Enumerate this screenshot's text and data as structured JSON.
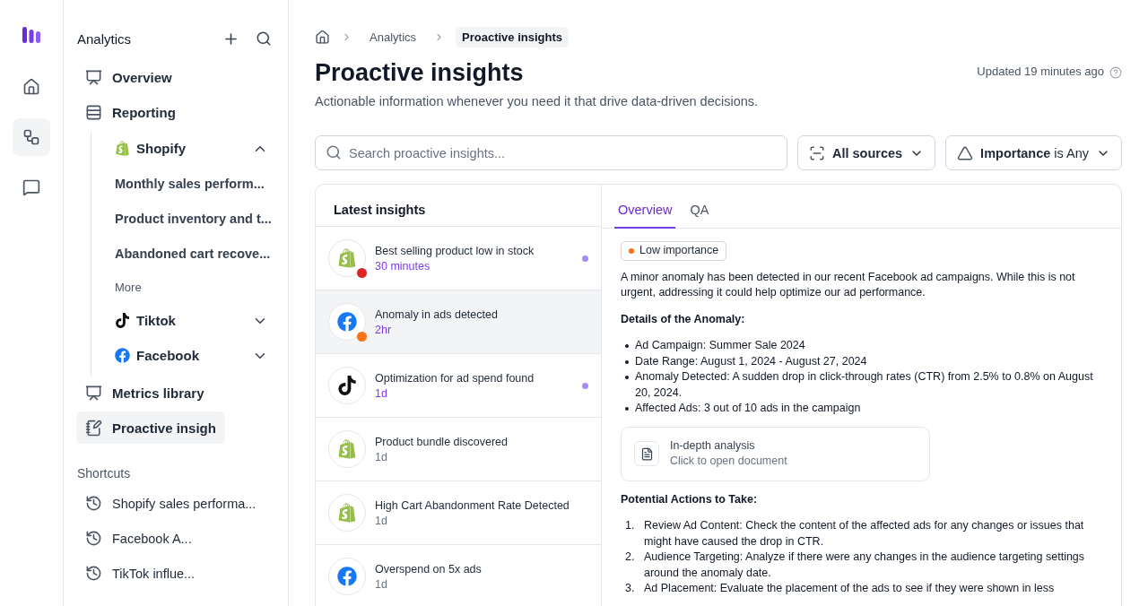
{
  "rail": {
    "items": [
      {
        "kind": "home",
        "selected": false
      },
      {
        "kind": "flows",
        "selected": true
      },
      {
        "kind": "chat",
        "selected": false
      }
    ]
  },
  "sidebar": {
    "title": "Analytics",
    "items": [
      {
        "kind": "overview",
        "label": "Overview",
        "selected": false
      },
      {
        "kind": "reporting",
        "label": "Reporting",
        "selected": false,
        "children": [
          {
            "kind": "shopify",
            "label": "Shopify",
            "expanded": true,
            "children": [
              {
                "label": "Monthly sales perform..."
              },
              {
                "label": "Product inventory and t..."
              },
              {
                "label": "Abandoned cart recove..."
              }
            ],
            "more": "More"
          },
          {
            "kind": "tiktok",
            "label": "Tiktok",
            "expanded": false
          },
          {
            "kind": "facebook",
            "label": "Facebook",
            "expanded": false
          }
        ]
      },
      {
        "kind": "overview",
        "label": "Metrics library",
        "selected": false
      },
      {
        "kind": "insights",
        "label": "Proactive insigh",
        "selected": true
      }
    ],
    "shortcuts_title": "Shortcuts",
    "shortcuts": [
      "Shopify sales performa...",
      "Facebook A...",
      "TikTok influe..."
    ]
  },
  "breadcrumb": [
    "Analytics",
    "Proactive insights"
  ],
  "page": {
    "title": "Proactive insights",
    "subtitle": "Actionable information whenever you need it that drive data-driven decisions.",
    "updated": "Updated 19 minutes ago"
  },
  "search": {
    "placeholder": "Search proactive insights..."
  },
  "filters": {
    "sources": "All sources",
    "importance": "**Importance** is Any"
  },
  "insights": {
    "title": "Latest insights",
    "items": [
      {
        "kind": "shopify",
        "title": "Best selling product low in stock",
        "time": "30 minutes",
        "recent": true,
        "unread": true,
        "selected": false,
        "color": "#dc2626"
      },
      {
        "kind": "facebook",
        "title": "Anomaly in ads detected",
        "time": "2hr",
        "recent": true,
        "unread": false,
        "selected": true,
        "color": "#f97316"
      },
      {
        "kind": "tiktok",
        "title": "Optimization for ad spend found",
        "time": "1d",
        "recent": true,
        "unread": true,
        "selected": false
      },
      {
        "kind": "shopify",
        "title": "Product bundle discovered",
        "time": "1d",
        "recent": false,
        "unread": false,
        "selected": false
      },
      {
        "kind": "shopify",
        "title": "High Cart Abandonment Rate Detected",
        "time": "1d",
        "recent": false,
        "unread": false,
        "selected": false
      },
      {
        "kind": "facebook",
        "title": "Overspend on 5x ads",
        "time": "1d",
        "recent": false,
        "unread": false,
        "selected": false
      }
    ]
  },
  "detail": {
    "tabs": [
      {
        "label": "Overview",
        "selected": true
      },
      {
        "label": "QA",
        "selected": false
      }
    ],
    "importance": {
      "label": "Low importance",
      "color": "#f97316"
    },
    "intro": "A minor anomaly has been detected in our recent Facebook ad campaigns. While this is not urgent, addressing it could help optimize our ad performance.",
    "details_title": "Details of the Anomaly:",
    "details": [
      "Ad Campaign: Summer Sale 2024",
      "Date Range: August 1, 2024 - August 27, 2024",
      "Anomaly Detected: A sudden drop in click-through rates (CTR) from 2.5% to 0.8% on August 20, 2024.",
      "Affected Ads: 3 out of 10 ads in the campaign"
    ],
    "document": {
      "title": "In-depth analysis",
      "subtitle": "Click to open document"
    },
    "actions_title": "Potential Actions to Take:",
    "actions": [
      {
        "number": "1.",
        "text": "Review Ad Content: Check the content of the affected ads for any changes or issues that might have caused the drop in CTR."
      },
      {
        "number": "2.",
        "text": "Audience Targeting: Analyze if there were any changes in the audience targeting settings around the anomaly date."
      },
      {
        "number": "3.",
        "text": "Ad Placement: Evaluate the placement of the ads to see if they were shown in less"
      }
    ]
  }
}
